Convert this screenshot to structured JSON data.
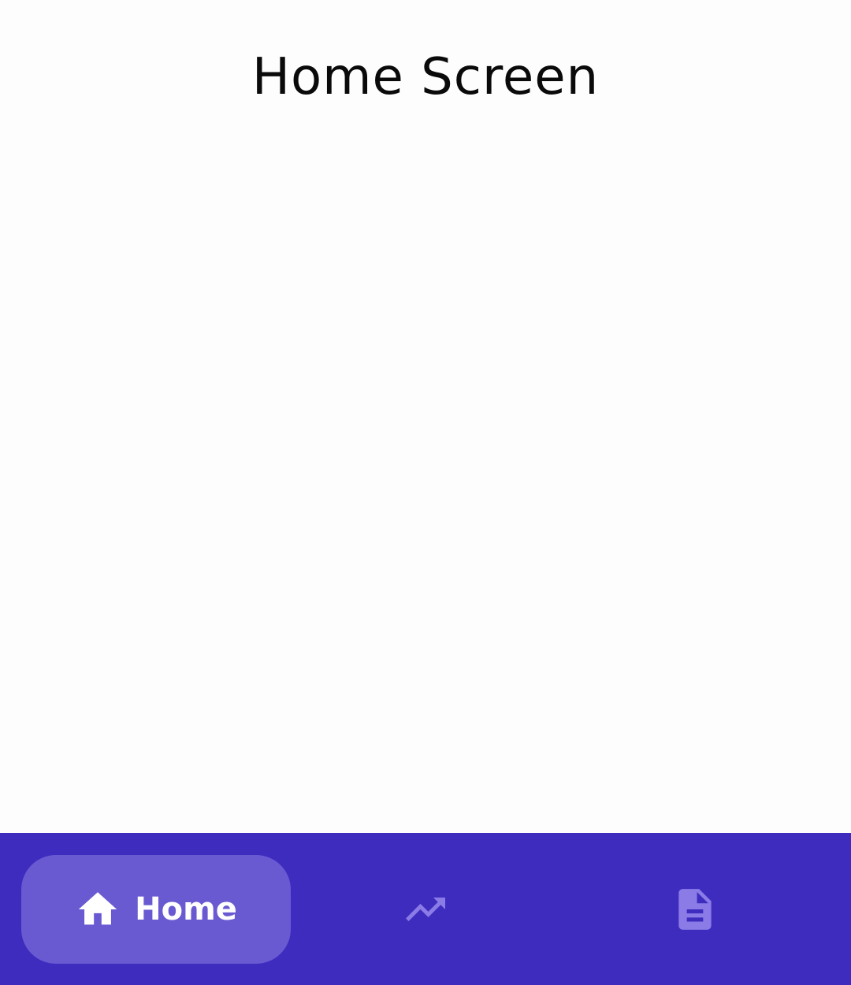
{
  "header": {
    "title": "Home Screen"
  },
  "bottom_nav": {
    "items": [
      {
        "label": "Home",
        "icon": "home-icon",
        "active": true
      },
      {
        "label": "",
        "icon": "trending-up-icon",
        "active": false
      },
      {
        "label": "",
        "icon": "document-icon",
        "active": false
      }
    ]
  },
  "colors": {
    "background": "#fdfdfd",
    "nav_background": "#3e2cbf",
    "active_pill": "#6a5ad2",
    "inactive_icon": "#8a7be6",
    "active_fg": "#ffffff",
    "title_text": "#0a0a0a"
  }
}
